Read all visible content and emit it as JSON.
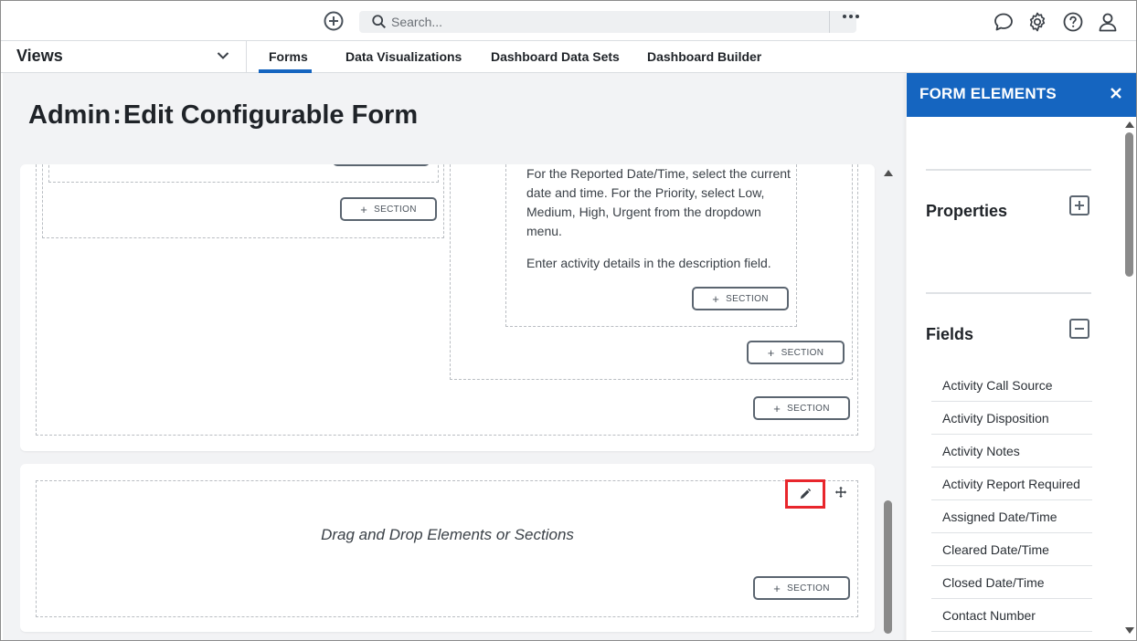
{
  "topbar": {
    "search_placeholder": "Search...",
    "icons": [
      "add-circle-icon",
      "search-icon",
      "more-horizontal-icon",
      "chat-icon",
      "gear-icon",
      "help-icon",
      "user-icon"
    ]
  },
  "nav": {
    "views_label": "Views",
    "tabs": [
      {
        "label": "Forms",
        "active": true
      },
      {
        "label": "Data Visualizations",
        "active": false
      },
      {
        "label": "Dashboard Data Sets",
        "active": false
      },
      {
        "label": "Dashboard Builder",
        "active": false
      }
    ]
  },
  "page": {
    "title_prefix": "Admin",
    "title_sep": ":",
    "title_main": "Edit Configurable Form"
  },
  "canvas": {
    "section_label": "SECTION",
    "description_lines": [
      "For the Reported Date/Time, select the current date and time. For the Priority, select Low, Medium, High, Urgent from the dropdown menu.",
      "Enter activity details in the description field."
    ],
    "drag_drop_text": "Drag and Drop Elements or Sections"
  },
  "panel": {
    "title": "FORM ELEMENTS",
    "properties_label": "Properties",
    "fields_label": "Fields",
    "fields": [
      "Activity Call Source",
      "Activity Disposition",
      "Activity Notes",
      "Activity Report Required",
      "Assigned Date/Time",
      "Cleared Date/Time",
      "Closed Date/Time",
      "Contact Number"
    ]
  },
  "colors": {
    "accent": "#1565c0",
    "highlight": "#e8262c",
    "background": "#f2f3f5"
  }
}
